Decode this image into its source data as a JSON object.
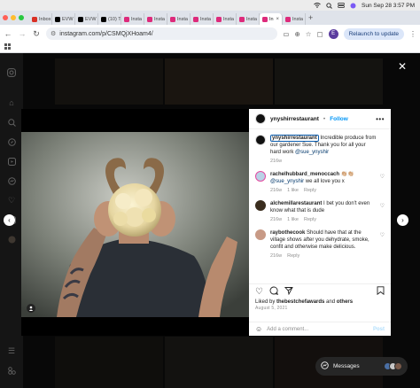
{
  "menubar": {
    "datetime": "Sun Sep 28  3:57 PM",
    "icons": [
      "wifi-icon",
      "search-icon",
      "control-center-icon",
      "siri-icon"
    ]
  },
  "browser": {
    "tabs": [
      {
        "label": "Inbox",
        "favicon": "gmail-icon",
        "favicon_color": "#d93025"
      },
      {
        "label": "EVW",
        "favicon": "x-icon",
        "favicon_color": "#000000"
      },
      {
        "label": "EVW",
        "favicon": "x-icon",
        "favicon_color": "#000000"
      },
      {
        "label": "(10) T",
        "favicon": "x-icon",
        "favicon_color": "#000000"
      },
      {
        "label": "Insta",
        "favicon": "instagram-icon",
        "favicon_color": "#dd2a7b"
      },
      {
        "label": "Insta",
        "favicon": "instagram-icon",
        "favicon_color": "#dd2a7b"
      },
      {
        "label": "Insta",
        "favicon": "instagram-icon",
        "favicon_color": "#dd2a7b"
      },
      {
        "label": "Insta",
        "favicon": "instagram-icon",
        "favicon_color": "#dd2a7b"
      },
      {
        "label": "Insta",
        "favicon": "instagram-icon",
        "favicon_color": "#dd2a7b"
      },
      {
        "label": "Insta",
        "favicon": "instagram-icon",
        "favicon_color": "#dd2a7b"
      },
      {
        "label": "In",
        "favicon": "instagram-icon",
        "favicon_color": "#dd2a7b"
      },
      {
        "label": "Insta",
        "favicon": "instagram-icon",
        "favicon_color": "#dd2a7b"
      }
    ],
    "url": "instagram.com/p/CSMQjXHoam4/",
    "relaunch_label": "Relaunch to update",
    "profile_initial": "E"
  },
  "post": {
    "username": "ynyshirrestaurant",
    "separator": "•",
    "follow_label": "Follow",
    "caption": {
      "username": "ynyshirrestaurant",
      "text": " Incredible produce from our gardener Sue. Thank you for all your hard work ",
      "mention": "@sue_ynyshir",
      "time": "216w"
    },
    "comments": [
      {
        "username": "rachelhubbard_menoccach",
        "text": " 👏🏼👏🏼",
        "mention": "@sue_ynyshir",
        "text2": " we all love you x",
        "time": "216w",
        "likes": "1 like",
        "reply": "Reply"
      },
      {
        "username": "alchemillarestaurant",
        "text": " I bet you don't even know what that is dude",
        "mention": "",
        "text2": "",
        "time": "216w",
        "likes": "1 like",
        "reply": "Reply"
      },
      {
        "username": "raybothecook",
        "text": " Should have that at the village shows after you dehydrate, smoke, confit and otherwise make delicious.",
        "mention": "",
        "text2": "",
        "time": "216w",
        "likes": "",
        "reply": "Reply"
      }
    ],
    "liked_by_prefix": "Liked by ",
    "liked_by_user": "thebestchefawards",
    "liked_by_and": " and ",
    "liked_by_others": "others",
    "date": "August 5, 2021",
    "add_comment_placeholder": "Add a comment...",
    "post_label": "Post"
  },
  "messages": {
    "label": "Messages"
  },
  "colors": {
    "accent": "#0095f6",
    "overlay": "#000000"
  }
}
